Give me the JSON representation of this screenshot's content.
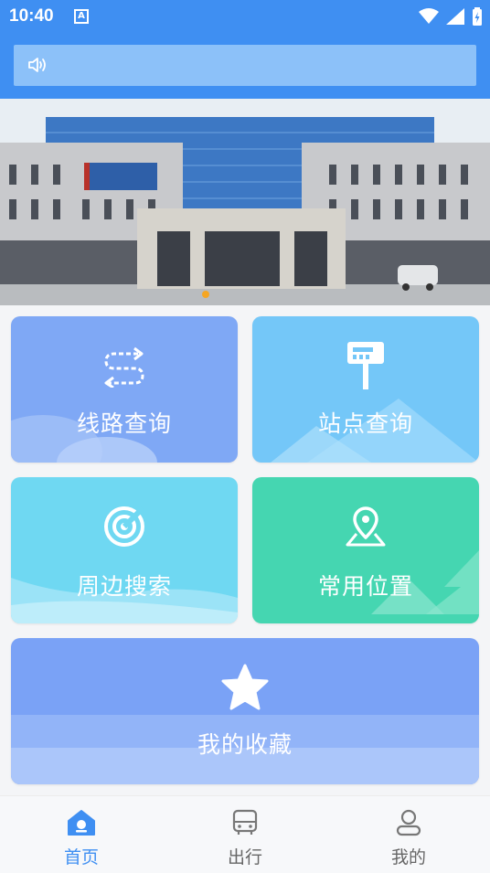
{
  "status_bar": {
    "time": "10:40",
    "notification_icon": "a-icon",
    "right_icons": [
      "wifi-icon",
      "signal-icon",
      "battery-icon"
    ]
  },
  "notice_bar": {
    "icon": "speaker-icon",
    "text": ""
  },
  "banner": {
    "image": "building-photo",
    "page_index": 1
  },
  "tiles": {
    "route_query": {
      "label": "线路查询",
      "icon": "route-arrows-icon",
      "color": "#7fa8f5"
    },
    "station_query": {
      "label": "站点查询",
      "icon": "bus-stop-sign-icon",
      "color": "#74c7f8"
    },
    "nearby_search": {
      "label": "周边搜索",
      "icon": "radar-icon",
      "color": "#6fd8f2"
    },
    "common_places": {
      "label": "常用位置",
      "icon": "location-pin-icon",
      "color": "#45d6b1"
    },
    "favorites": {
      "label": "我的收藏",
      "icon": "star-icon",
      "color": "#7aa2f6"
    }
  },
  "tab_bar": {
    "items": [
      {
        "label": "首页",
        "icon": "home-icon",
        "active": true
      },
      {
        "label": "出行",
        "icon": "bus-icon",
        "active": false
      },
      {
        "label": "我的",
        "icon": "user-icon",
        "active": false
      }
    ],
    "active_color": "#3f8ff2"
  }
}
